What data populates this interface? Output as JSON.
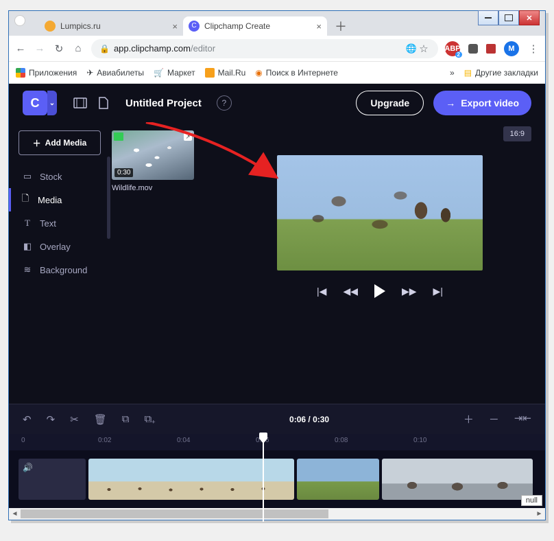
{
  "window": {
    "minimize": "",
    "maximize": "",
    "close": ""
  },
  "tabs": [
    {
      "title": "Lumpics.ru",
      "favColor": "#f4a933",
      "active": false
    },
    {
      "title": "Clipchamp Create",
      "favColor": "#5b5ff6",
      "active": true
    }
  ],
  "newTabGlyph": "＋",
  "address": {
    "back": "←",
    "forward": "→",
    "reload": "↻",
    "home": "⌂",
    "secure": "🔒",
    "domain": "app.clipchamp.com",
    "path": "/editor",
    "translate": "⠿",
    "star": "☆",
    "extensions": {
      "abp": "ABP",
      "evernote": "N",
      "acrobat": "A"
    },
    "profile": "M",
    "menu": "⋮"
  },
  "bookmarks": {
    "apps": "Приложения",
    "items": [
      "Авиабилеты",
      "Маркет",
      "Mail.Ru",
      "Поиск в Интернете"
    ],
    "more": "»",
    "other": "Другие закладки"
  },
  "app": {
    "logo": "C",
    "logoCaret": "⌄",
    "icons": {
      "film": "▦",
      "file": "🗋"
    },
    "projectTitle": "Untitled Project",
    "help": "?",
    "upgrade": "Upgrade",
    "export": "Export video",
    "exportArrow": "→"
  },
  "sidebar": {
    "addMedia": "Add Media",
    "addPlus": "＋",
    "items": [
      {
        "icon": "☰",
        "label": "Stock"
      },
      {
        "icon": "🗋",
        "label": "Media",
        "active": true
      },
      {
        "icon": "T",
        "label": "Text"
      },
      {
        "icon": "◧",
        "label": "Overlay"
      },
      {
        "icon": "≋",
        "label": "Background"
      }
    ]
  },
  "media": {
    "duration": "0:30",
    "filename": "Wildlife.mov"
  },
  "preview": {
    "ratio": "16:9",
    "controls": {
      "first": "|◀",
      "prev": "◀◀",
      "next": "▶▶",
      "last": "▶|"
    }
  },
  "timeline": {
    "toolbar": {
      "undo": "↶",
      "redo": "↷",
      "cut": "✂",
      "delete": "🗑",
      "copy": "⧉",
      "paste": "⧉₊",
      "time": "0:06 / 0:30",
      "zoomIn": "＋",
      "zoomOut": "－",
      "fit": "⇥⇤"
    },
    "ruler": [
      "0",
      "0:02",
      "0:04",
      "0:06",
      "0:08",
      "0:10"
    ],
    "playheadPercent": 52,
    "audioIcon": "🔊"
  },
  "nullLabel": "null"
}
